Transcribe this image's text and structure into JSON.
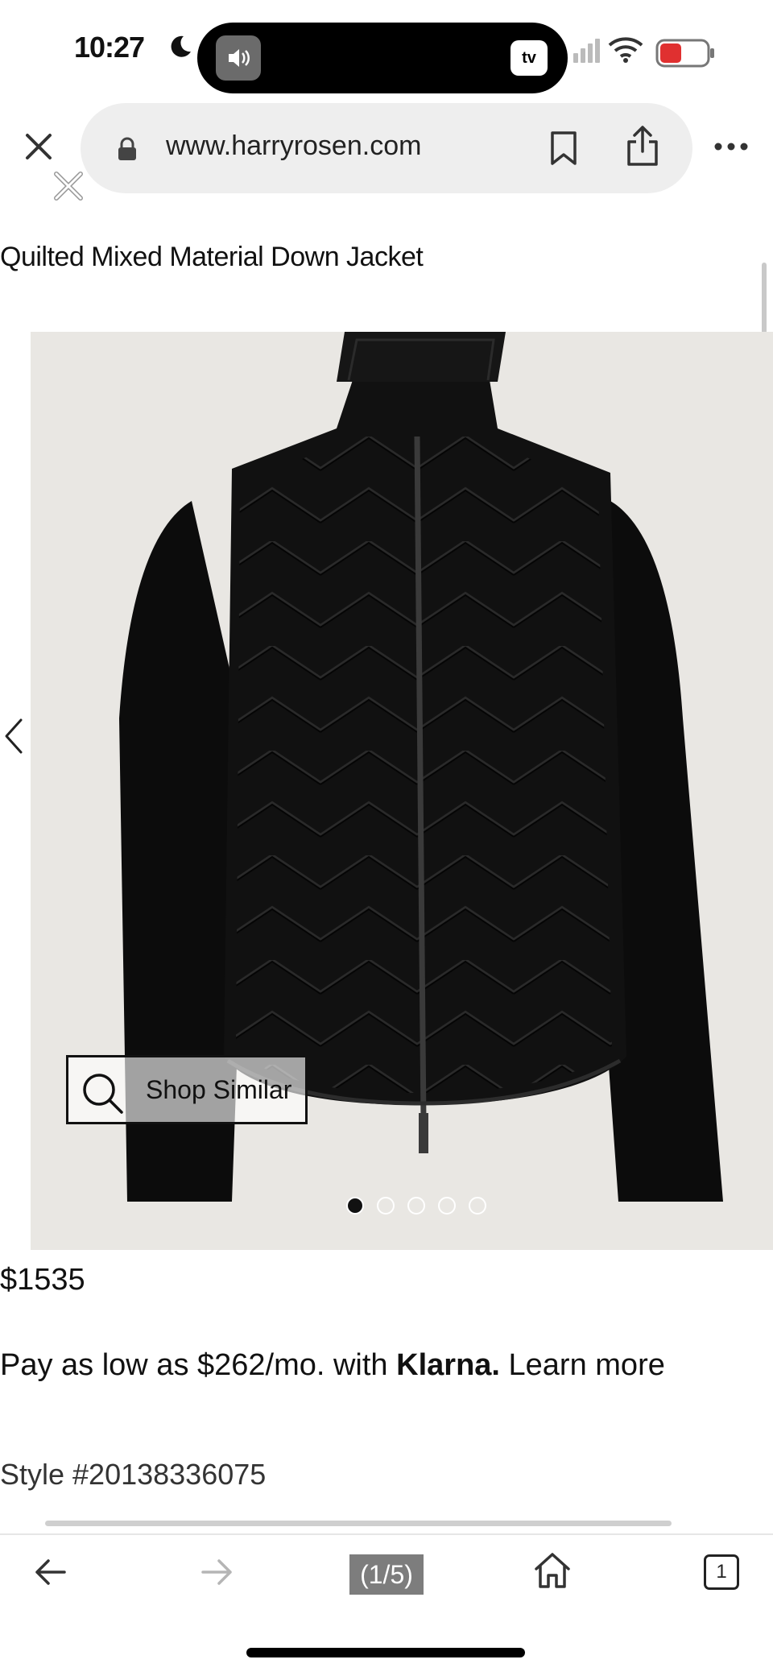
{
  "status_bar": {
    "time": "10:27",
    "island_right_label": "tv"
  },
  "browser": {
    "url": "www.harryrosen.com"
  },
  "product": {
    "title": "Quilted Mixed Material Down Jacket",
    "shop_similar_label": "Shop Similar",
    "image_count": 5,
    "active_image": 1,
    "price": "$1535",
    "financing_prefix": "Pay as low as $262/mo. with ",
    "financing_brand": "Klarna.",
    "financing_link": "Learn more",
    "style_number": "Style #20138336075"
  },
  "toolbar": {
    "page_counter": "(1/5)",
    "tab_count": "1"
  },
  "colors": {
    "photo_background": "#e9e7e3",
    "jacket": "#111111",
    "urlbar": "#eeeeee"
  }
}
